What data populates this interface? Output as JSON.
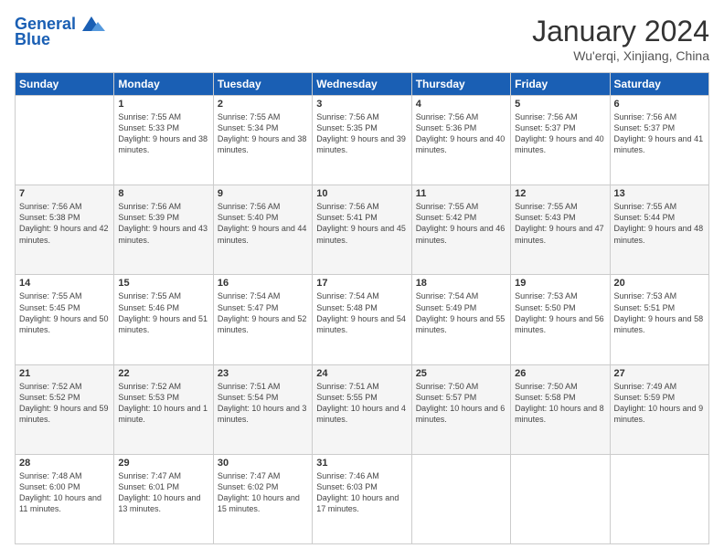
{
  "logo": {
    "line1": "General",
    "line2": "Blue"
  },
  "title": "January 2024",
  "subtitle": "Wu'erqi, Xinjiang, China",
  "weekdays": [
    "Sunday",
    "Monday",
    "Tuesday",
    "Wednesday",
    "Thursday",
    "Friday",
    "Saturday"
  ],
  "weeks": [
    [
      {
        "day": "",
        "sunrise": "",
        "sunset": "",
        "daylight": ""
      },
      {
        "day": "1",
        "sunrise": "Sunrise: 7:55 AM",
        "sunset": "Sunset: 5:33 PM",
        "daylight": "Daylight: 9 hours and 38 minutes."
      },
      {
        "day": "2",
        "sunrise": "Sunrise: 7:55 AM",
        "sunset": "Sunset: 5:34 PM",
        "daylight": "Daylight: 9 hours and 38 minutes."
      },
      {
        "day": "3",
        "sunrise": "Sunrise: 7:56 AM",
        "sunset": "Sunset: 5:35 PM",
        "daylight": "Daylight: 9 hours and 39 minutes."
      },
      {
        "day": "4",
        "sunrise": "Sunrise: 7:56 AM",
        "sunset": "Sunset: 5:36 PM",
        "daylight": "Daylight: 9 hours and 40 minutes."
      },
      {
        "day": "5",
        "sunrise": "Sunrise: 7:56 AM",
        "sunset": "Sunset: 5:37 PM",
        "daylight": "Daylight: 9 hours and 40 minutes."
      },
      {
        "day": "6",
        "sunrise": "Sunrise: 7:56 AM",
        "sunset": "Sunset: 5:37 PM",
        "daylight": "Daylight: 9 hours and 41 minutes."
      }
    ],
    [
      {
        "day": "7",
        "sunrise": "Sunrise: 7:56 AM",
        "sunset": "Sunset: 5:38 PM",
        "daylight": "Daylight: 9 hours and 42 minutes."
      },
      {
        "day": "8",
        "sunrise": "Sunrise: 7:56 AM",
        "sunset": "Sunset: 5:39 PM",
        "daylight": "Daylight: 9 hours and 43 minutes."
      },
      {
        "day": "9",
        "sunrise": "Sunrise: 7:56 AM",
        "sunset": "Sunset: 5:40 PM",
        "daylight": "Daylight: 9 hours and 44 minutes."
      },
      {
        "day": "10",
        "sunrise": "Sunrise: 7:56 AM",
        "sunset": "Sunset: 5:41 PM",
        "daylight": "Daylight: 9 hours and 45 minutes."
      },
      {
        "day": "11",
        "sunrise": "Sunrise: 7:55 AM",
        "sunset": "Sunset: 5:42 PM",
        "daylight": "Daylight: 9 hours and 46 minutes."
      },
      {
        "day": "12",
        "sunrise": "Sunrise: 7:55 AM",
        "sunset": "Sunset: 5:43 PM",
        "daylight": "Daylight: 9 hours and 47 minutes."
      },
      {
        "day": "13",
        "sunrise": "Sunrise: 7:55 AM",
        "sunset": "Sunset: 5:44 PM",
        "daylight": "Daylight: 9 hours and 48 minutes."
      }
    ],
    [
      {
        "day": "14",
        "sunrise": "Sunrise: 7:55 AM",
        "sunset": "Sunset: 5:45 PM",
        "daylight": "Daylight: 9 hours and 50 minutes."
      },
      {
        "day": "15",
        "sunrise": "Sunrise: 7:55 AM",
        "sunset": "Sunset: 5:46 PM",
        "daylight": "Daylight: 9 hours and 51 minutes."
      },
      {
        "day": "16",
        "sunrise": "Sunrise: 7:54 AM",
        "sunset": "Sunset: 5:47 PM",
        "daylight": "Daylight: 9 hours and 52 minutes."
      },
      {
        "day": "17",
        "sunrise": "Sunrise: 7:54 AM",
        "sunset": "Sunset: 5:48 PM",
        "daylight": "Daylight: 9 hours and 54 minutes."
      },
      {
        "day": "18",
        "sunrise": "Sunrise: 7:54 AM",
        "sunset": "Sunset: 5:49 PM",
        "daylight": "Daylight: 9 hours and 55 minutes."
      },
      {
        "day": "19",
        "sunrise": "Sunrise: 7:53 AM",
        "sunset": "Sunset: 5:50 PM",
        "daylight": "Daylight: 9 hours and 56 minutes."
      },
      {
        "day": "20",
        "sunrise": "Sunrise: 7:53 AM",
        "sunset": "Sunset: 5:51 PM",
        "daylight": "Daylight: 9 hours and 58 minutes."
      }
    ],
    [
      {
        "day": "21",
        "sunrise": "Sunrise: 7:52 AM",
        "sunset": "Sunset: 5:52 PM",
        "daylight": "Daylight: 9 hours and 59 minutes."
      },
      {
        "day": "22",
        "sunrise": "Sunrise: 7:52 AM",
        "sunset": "Sunset: 5:53 PM",
        "daylight": "Daylight: 10 hours and 1 minute."
      },
      {
        "day": "23",
        "sunrise": "Sunrise: 7:51 AM",
        "sunset": "Sunset: 5:54 PM",
        "daylight": "Daylight: 10 hours and 3 minutes."
      },
      {
        "day": "24",
        "sunrise": "Sunrise: 7:51 AM",
        "sunset": "Sunset: 5:55 PM",
        "daylight": "Daylight: 10 hours and 4 minutes."
      },
      {
        "day": "25",
        "sunrise": "Sunrise: 7:50 AM",
        "sunset": "Sunset: 5:57 PM",
        "daylight": "Daylight: 10 hours and 6 minutes."
      },
      {
        "day": "26",
        "sunrise": "Sunrise: 7:50 AM",
        "sunset": "Sunset: 5:58 PM",
        "daylight": "Daylight: 10 hours and 8 minutes."
      },
      {
        "day": "27",
        "sunrise": "Sunrise: 7:49 AM",
        "sunset": "Sunset: 5:59 PM",
        "daylight": "Daylight: 10 hours and 9 minutes."
      }
    ],
    [
      {
        "day": "28",
        "sunrise": "Sunrise: 7:48 AM",
        "sunset": "Sunset: 6:00 PM",
        "daylight": "Daylight: 10 hours and 11 minutes."
      },
      {
        "day": "29",
        "sunrise": "Sunrise: 7:47 AM",
        "sunset": "Sunset: 6:01 PM",
        "daylight": "Daylight: 10 hours and 13 minutes."
      },
      {
        "day": "30",
        "sunrise": "Sunrise: 7:47 AM",
        "sunset": "Sunset: 6:02 PM",
        "daylight": "Daylight: 10 hours and 15 minutes."
      },
      {
        "day": "31",
        "sunrise": "Sunrise: 7:46 AM",
        "sunset": "Sunset: 6:03 PM",
        "daylight": "Daylight: 10 hours and 17 minutes."
      },
      {
        "day": "",
        "sunrise": "",
        "sunset": "",
        "daylight": ""
      },
      {
        "day": "",
        "sunrise": "",
        "sunset": "",
        "daylight": ""
      },
      {
        "day": "",
        "sunrise": "",
        "sunset": "",
        "daylight": ""
      }
    ]
  ],
  "accent_color": "#1a5fb4"
}
